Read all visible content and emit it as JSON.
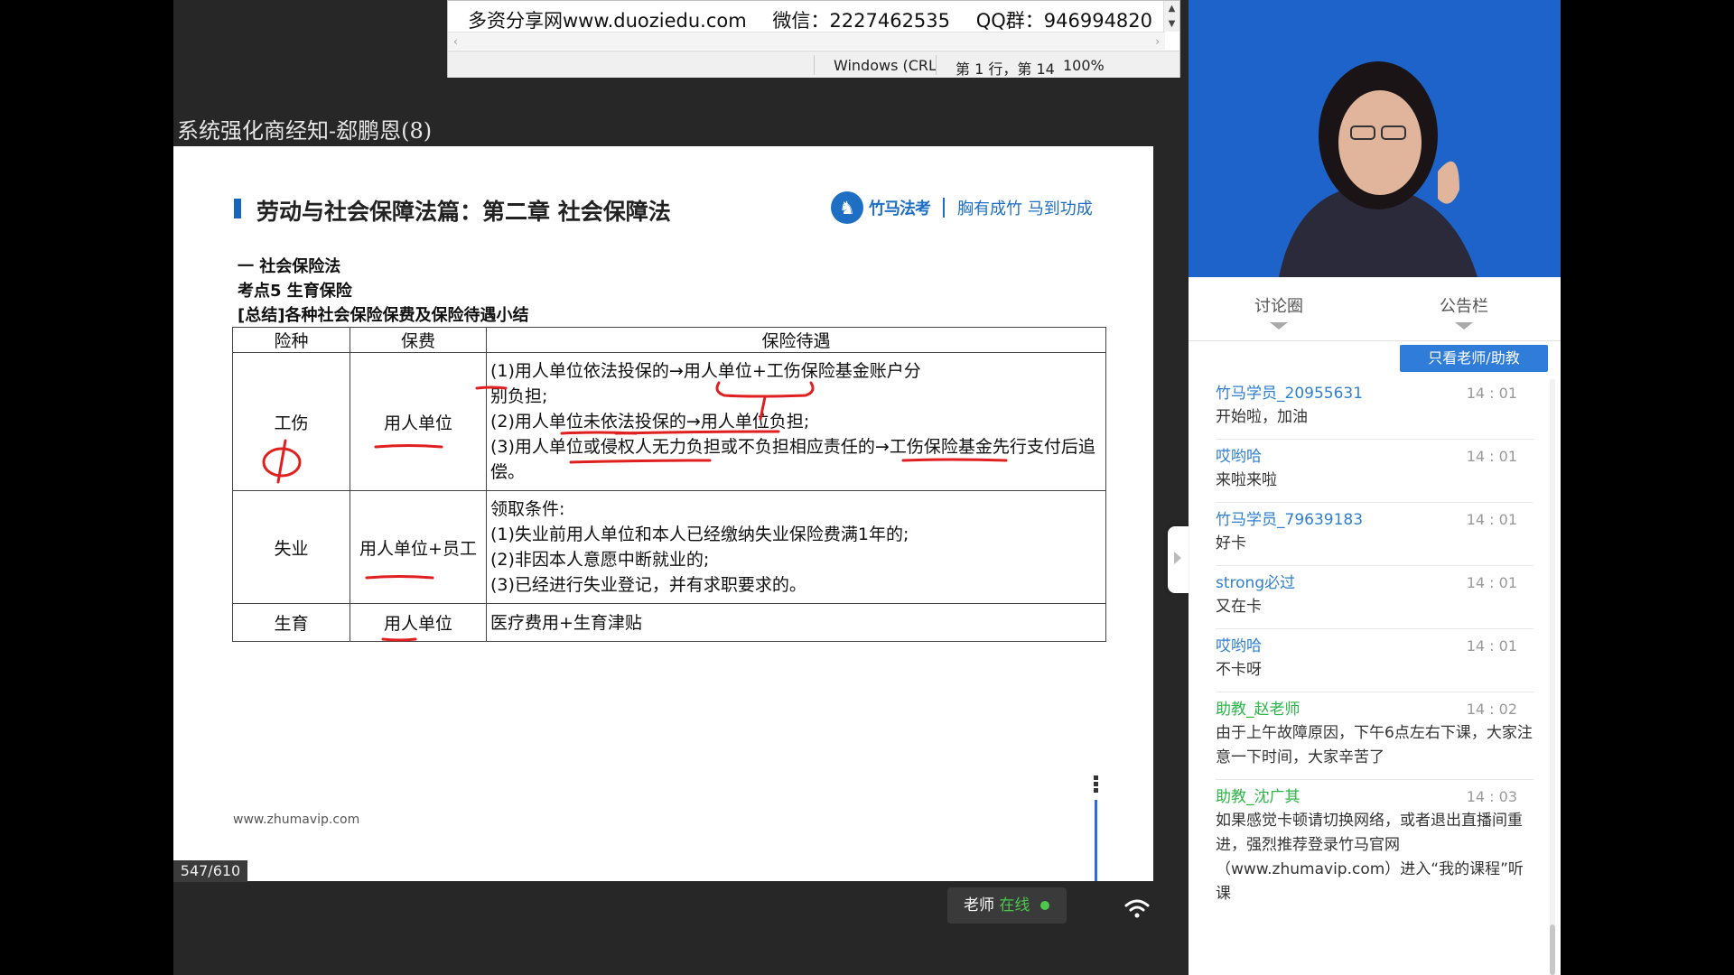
{
  "notepad": {
    "line_site": "多资分享网www.duoziedu.com",
    "line_wechat": "微信：2227462535",
    "line_qq": "QQ群：946994820",
    "status_encoding": "Windows (CRL",
    "status_position": "第 1 行，第 14",
    "status_zoom": "100%"
  },
  "lesson_title": "系统强化商经知-郄鹏恩(8)",
  "slide": {
    "heading": "劳动与社会保障法篇：第二章  社会保障法",
    "brand_name": "竹马法考",
    "brand_slogan": "胸有成竹 马到功成",
    "section1": "一  社会保险法",
    "section2": "考点5 生育保险",
    "section3": "[总结]各种社会保险保费及保险待遇小结",
    "table": {
      "headers": [
        "险种",
        "保费",
        "保险待遇"
      ],
      "rows": [
        {
          "type": "工伤",
          "premium": "用人单位",
          "benefits": [
            "(1)用人单位依法投保的→用人单位+工伤保险基金账户分",
            "别负担;",
            "(2)用人单位未依法投保的→用人单位负担;",
            "(3)用人单位或侵权人无力负担或不负担相应责任的→工伤保险基金先行支付后追",
            "偿。"
          ]
        },
        {
          "type": "失业",
          "premium": "用人单位+员工",
          "benefits": [
            "领取条件:",
            "(1)失业前用人单位和本人已经缴纳失业保险费满1年的;",
            "(2)非因本人意愿中断就业的;",
            "(3)已经进行失业登记，并有求职要求的。"
          ]
        },
        {
          "type": "生育",
          "premium": "用人单位",
          "benefits": [
            "医疗费用+生育津贴"
          ]
        }
      ]
    },
    "footer_url": "www.zhumavip.com"
  },
  "page_counter": "547/610",
  "teacher_status": {
    "label": "老师",
    "state": "在线"
  },
  "side_panel": {
    "tab_discussion": "讨论圈",
    "tab_bulletin": "公告栏",
    "filter_button": "只看老师/助教",
    "messages": [
      {
        "name": "竹马学员_20955631",
        "time": "14 : 01",
        "text": "开始啦，加油",
        "staff": false
      },
      {
        "name": "哎哟哈",
        "time": "14 : 01",
        "text": "来啦来啦",
        "staff": false
      },
      {
        "name": "竹马学员_79639183",
        "time": "14 : 01",
        "text": "好卡",
        "staff": false
      },
      {
        "name": "strong必过",
        "time": "14 : 01",
        "text": "又在卡",
        "staff": false
      },
      {
        "name": "哎哟哈",
        "time": "14 : 01",
        "text": "不卡呀",
        "staff": false
      },
      {
        "name": "助教_赵老师",
        "time": "14 : 02",
        "text": "由于上午故障原因，下午6点左右下课，大家注意一下时间，大家辛苦了",
        "staff": true
      },
      {
        "name": "助教_沈广其",
        "time": "14 : 03",
        "text": "如果感觉卡顿请切换网络，或者退出直播间重进，强烈推荐登录竹马官网（www.zhumavip.com）进入“我的课程”听课",
        "staff": true
      }
    ]
  },
  "colors": {
    "accent": "#2f7dd8",
    "staff_name": "#2db44a",
    "annotation": "#e02020",
    "video_bg": "#1d63c9"
  }
}
